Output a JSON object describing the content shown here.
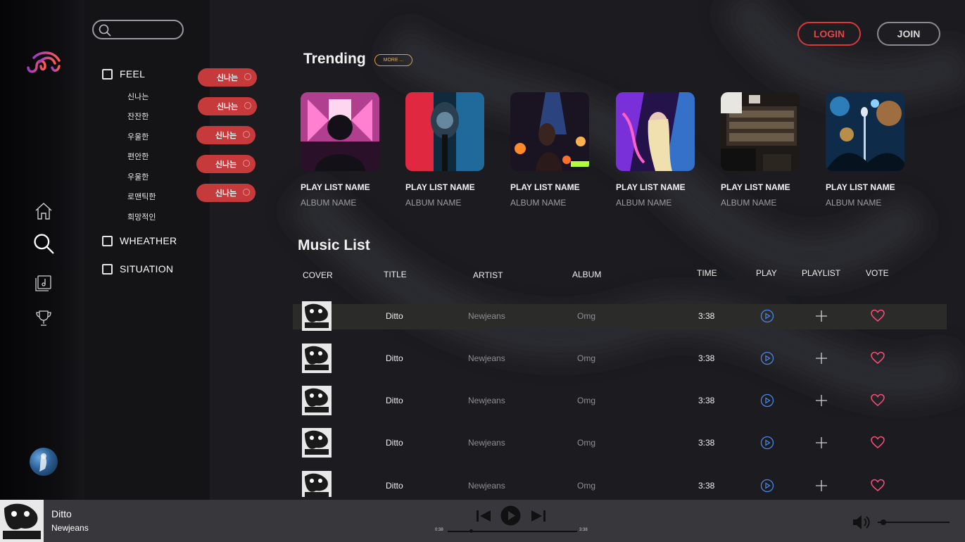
{
  "search": {
    "placeholder": ""
  },
  "filters": {
    "categories": [
      {
        "label": "FEEL"
      },
      {
        "label": "WHEATHER"
      },
      {
        "label": "SITUATION"
      }
    ],
    "feel_items": [
      "신나는",
      "잔잔한",
      "우울한",
      "편안한",
      "우울한",
      "로맨틱한",
      "희망적인"
    ],
    "chips": [
      "신나는",
      "신나는",
      "신나는",
      "신나는",
      "신나는"
    ]
  },
  "header": {
    "login_label": "LOGIN",
    "join_label": "JOIN"
  },
  "trending": {
    "title": "Trending",
    "more_label": "MORE ...",
    "cards": [
      {
        "playlist": "PLAY LIST NAME",
        "album": "ALBUM NAME"
      },
      {
        "playlist": "PLAY LIST NAME",
        "album": "ALBUM NAME"
      },
      {
        "playlist": "PLAY LIST NAME",
        "album": "ALBUM NAME"
      },
      {
        "playlist": "PLAY LIST NAME",
        "album": "ALBUM NAME"
      },
      {
        "playlist": "PLAY LIST NAME",
        "album": "ALBUM NAME"
      },
      {
        "playlist": "PLAY LIST NAME",
        "album": "ALBUM NAME"
      }
    ]
  },
  "music_list": {
    "title": "Music List",
    "columns": [
      "COVER",
      "TITLE",
      "ARTIST",
      "ALBUM",
      "TIME",
      "PLAY",
      "PLAYLIST",
      "VOTE"
    ],
    "rows": [
      {
        "title": "Ditto",
        "artist": "Newjeans",
        "album": "Omg",
        "time": "3:38"
      },
      {
        "title": "Ditto",
        "artist": "Newjeans",
        "album": "Omg",
        "time": "3:38"
      },
      {
        "title": "Ditto",
        "artist": "Newjeans",
        "album": "Omg",
        "time": "3:38"
      },
      {
        "title": "Ditto",
        "artist": "Newjeans",
        "album": "Omg",
        "time": "3:38"
      },
      {
        "title": "Ditto",
        "artist": "Newjeans",
        "album": "Omg",
        "time": "3:38"
      }
    ]
  },
  "player": {
    "title": "Ditto",
    "artist": "Newjeans",
    "elapsed": "0:38",
    "duration": "3:38",
    "progress": 0.18,
    "volume": 0.05
  },
  "colors": {
    "accent_red": "#c63a3c",
    "play_blue": "#4a86e0",
    "heart_pink": "#ff4d7a",
    "more_gold": "#d7a24a"
  },
  "icons": {
    "rail": [
      "home-icon",
      "search-icon",
      "music-library-icon",
      "trophy-icon"
    ],
    "row": [
      "play-circle-icon",
      "plus-icon",
      "heart-icon"
    ],
    "player": [
      "skip-previous-icon",
      "play-icon",
      "skip-next-icon",
      "volume-icon"
    ]
  }
}
